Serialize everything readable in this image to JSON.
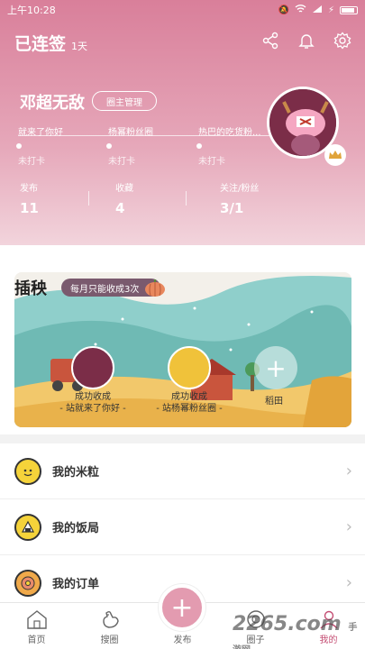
{
  "status_bar": {
    "time": "上午10:28"
  },
  "header": {
    "streak_title": "已连签",
    "streak_days": "1天"
  },
  "profile": {
    "name": "邓超无敌",
    "manage_label": "圈主管理",
    "circles": [
      {
        "name": "就来了你好",
        "state": "未打卡"
      },
      {
        "name": "杨幂粉丝圈",
        "state": "未打卡"
      },
      {
        "name": "热巴的吃货粉...",
        "state": "未打卡"
      }
    ],
    "stats": [
      {
        "label": "发布",
        "value": "11"
      },
      {
        "label": "收藏",
        "value": "4"
      },
      {
        "label": "关注/粉丝",
        "value": "3/1"
      }
    ]
  },
  "harvest": {
    "title": "插秧",
    "tag": "每月只能收成3次",
    "members": [
      {
        "line1": "成功收成",
        "line2": "- 站就来了你好 -"
      },
      {
        "line1": "成功收成",
        "line2": "- 站杨幂粉丝圈 -"
      }
    ],
    "add_label": "稻田"
  },
  "menu": {
    "items": [
      {
        "label": "我的米粒"
      },
      {
        "label": "我的饭局"
      },
      {
        "label": "我的订单"
      }
    ]
  },
  "tabbar": {
    "tabs": [
      {
        "label": "首页"
      },
      {
        "label": "搜圈"
      },
      {
        "label": "发布"
      },
      {
        "label": "圈子"
      },
      {
        "label": "我的"
      }
    ]
  },
  "watermark": {
    "text": "2265.com",
    "sub": "手游网"
  },
  "colors": {
    "accent": "#c44d73",
    "header": "#d97f9a",
    "publish": "#e39bb0"
  }
}
